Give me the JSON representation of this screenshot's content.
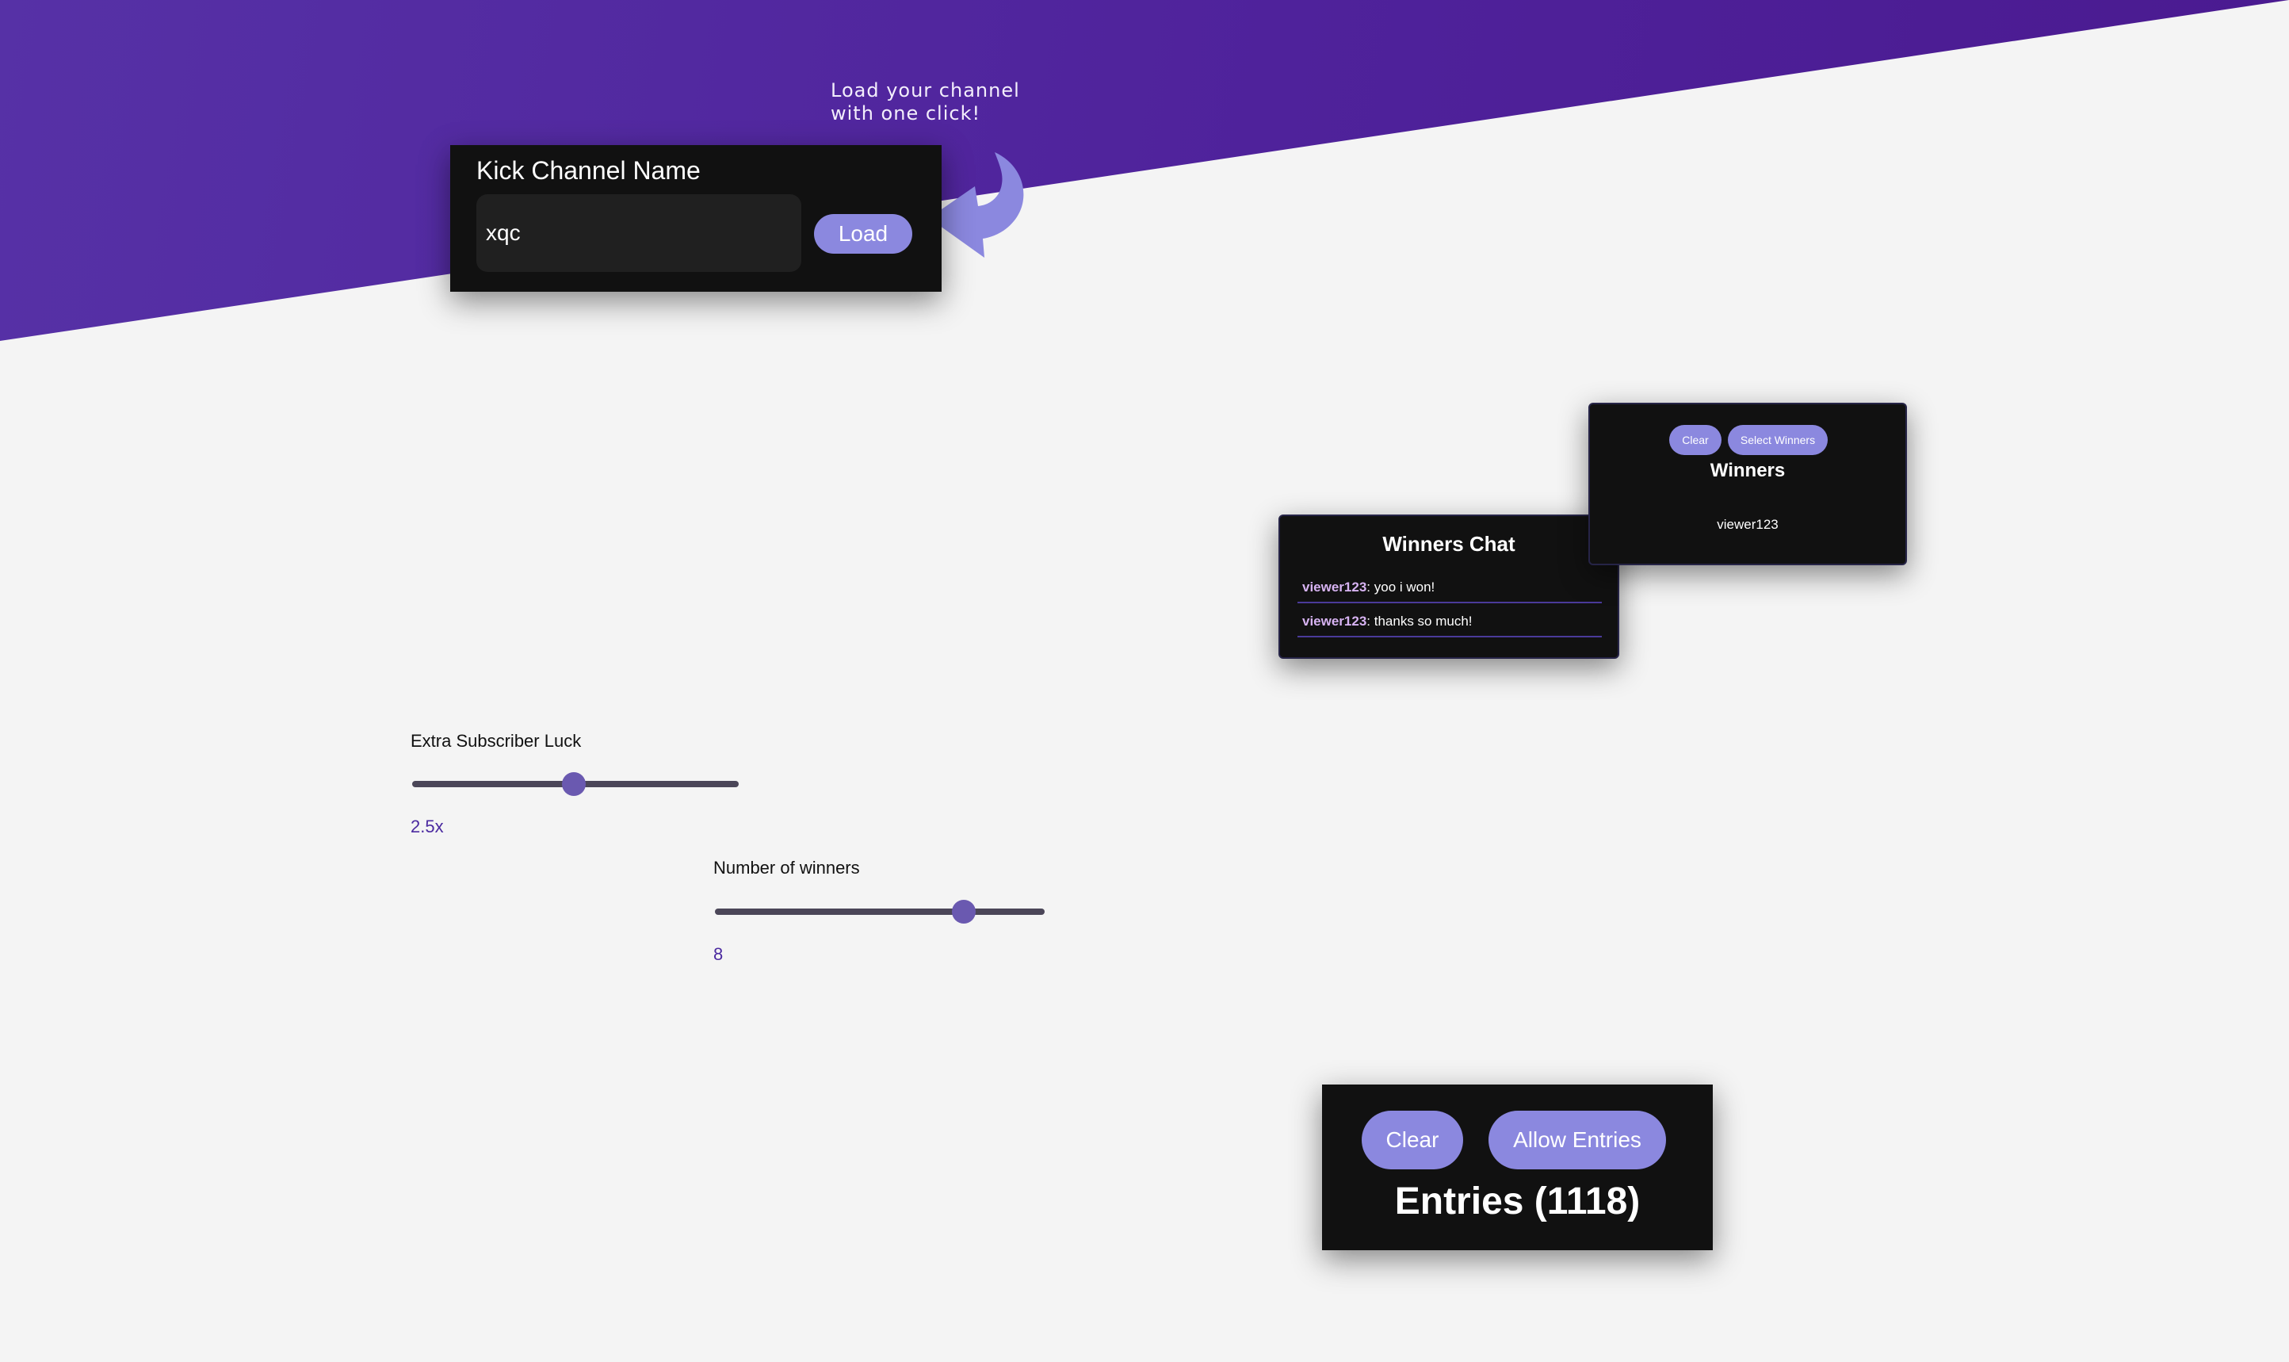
{
  "annotation": {
    "line1": "Load your channel",
    "line2": "with one click!"
  },
  "channel": {
    "title": "Kick Channel Name",
    "input_value": "xqc",
    "load_label": "Load"
  },
  "winners_panel": {
    "clear_label": "Clear",
    "select_label": "Select Winners",
    "title": "Winners",
    "items": [
      "viewer123"
    ]
  },
  "winners_chat": {
    "title": "Winners Chat",
    "messages": [
      {
        "user": "viewer123",
        "text": ": yoo i won!"
      },
      {
        "user": "viewer123",
        "text": ": thanks so much!"
      }
    ]
  },
  "subscriber_luck": {
    "label": "Extra Subscriber Luck",
    "value_text": "2.5x",
    "fill_fraction": 0.5
  },
  "number_of_winners": {
    "label": "Number of winners",
    "value_text": "8",
    "fill_fraction": 0.77
  },
  "entries": {
    "clear_label": "Clear",
    "allow_label": "Allow Entries",
    "title": "Entries (1118)"
  },
  "colors": {
    "hero_purple": "#5631a6",
    "accent_button": "#8b88df",
    "panel_bg": "#111111",
    "chat_username": "#d7b3f2",
    "slider_thumb": "#6a59b0"
  }
}
